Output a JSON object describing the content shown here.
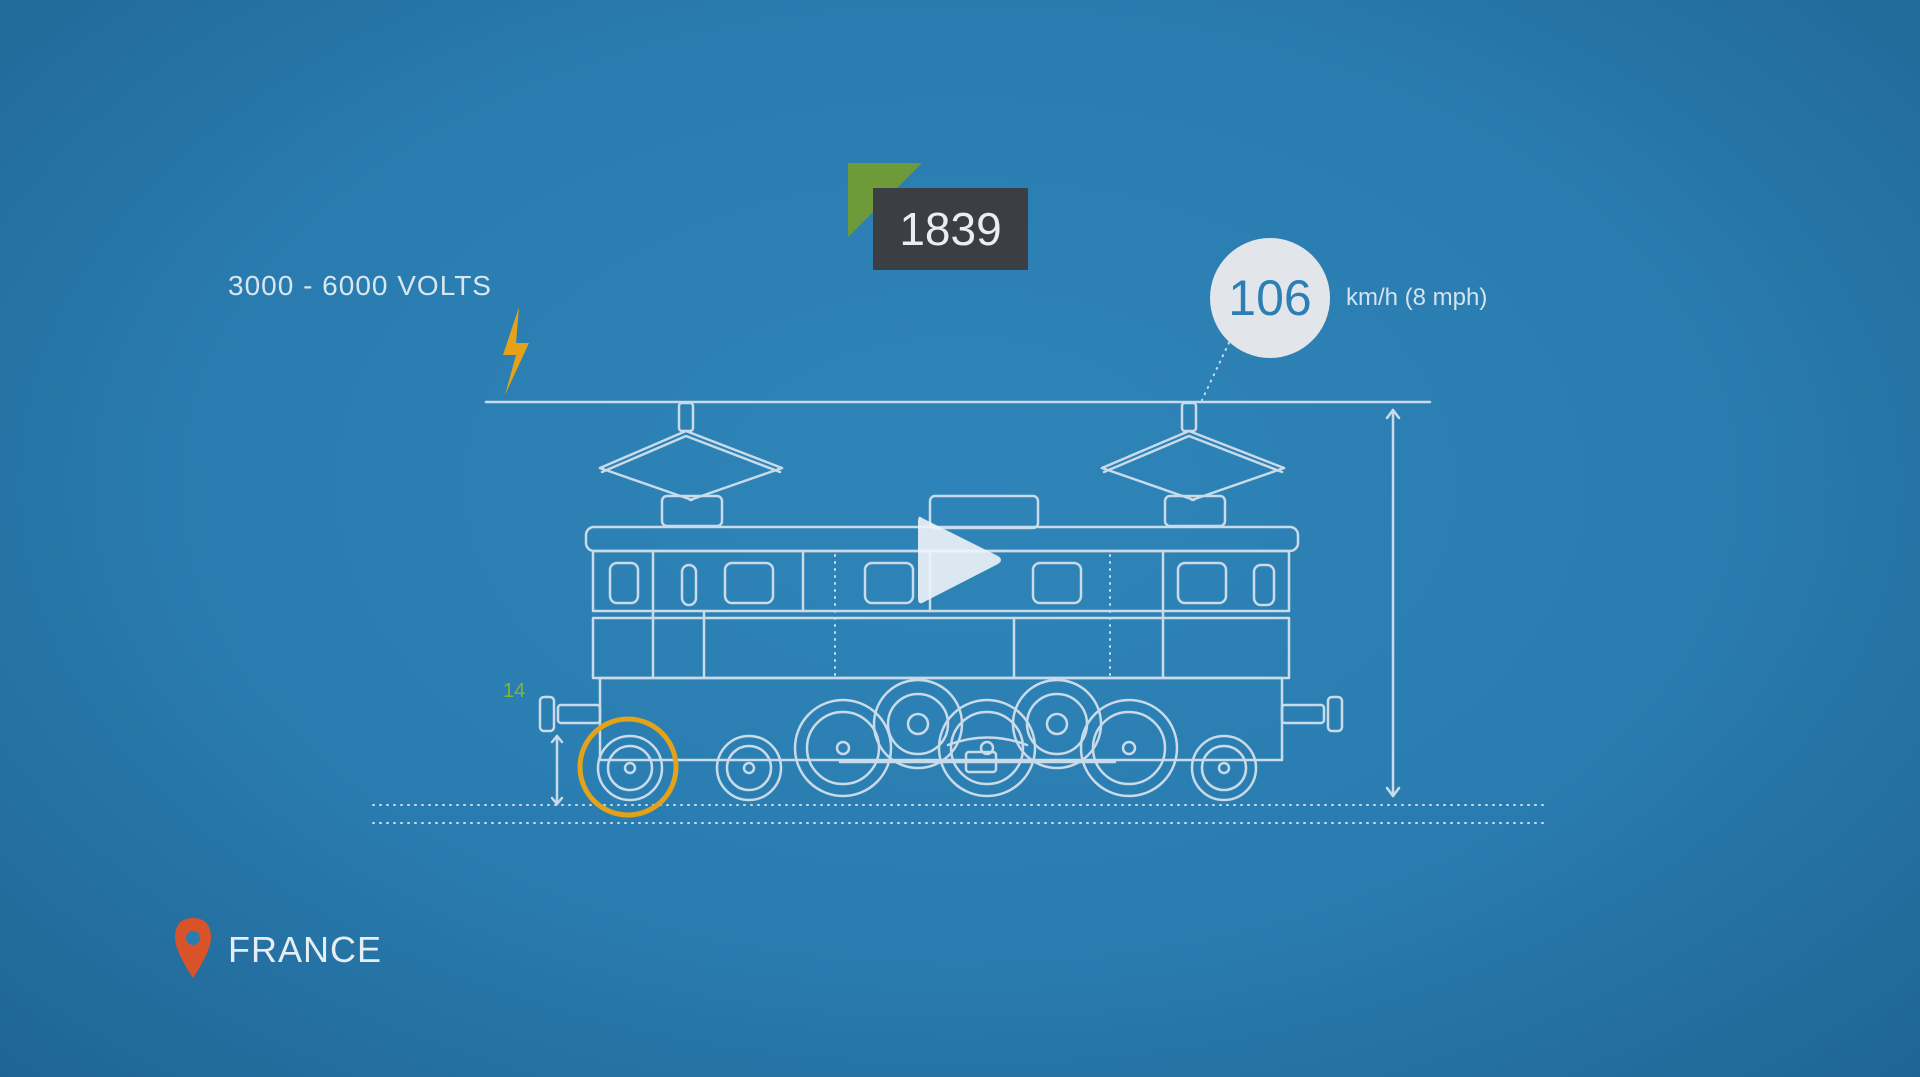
{
  "year": "1839",
  "voltage": "3000 - 6000 VOLTS",
  "speed": {
    "value": "106",
    "unit": "km/h (8 mph)"
  },
  "spec_number": "14",
  "country": "FRANCE",
  "colors": {
    "background": "#2a7cb0",
    "line": "#c9dbe8",
    "accent_green": "#6f9a3a",
    "accent_orange": "#e3a21a",
    "pin_red": "#d9532a",
    "badge_dark": "#3b3f44"
  },
  "icons": {
    "lightning": "lightning-bolt-icon",
    "location": "map-pin-icon",
    "play": "play-icon"
  }
}
